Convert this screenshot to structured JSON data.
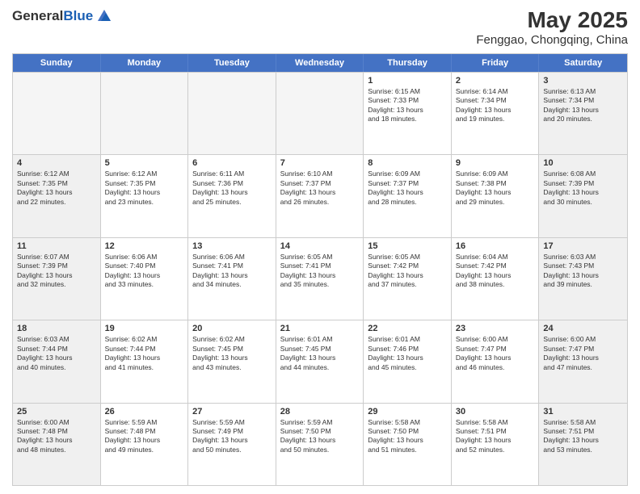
{
  "header": {
    "logo_line1": "General",
    "logo_line2": "Blue",
    "title": "May 2025",
    "subtitle": "Fenggao, Chongqing, China"
  },
  "weekdays": [
    "Sunday",
    "Monday",
    "Tuesday",
    "Wednesday",
    "Thursday",
    "Friday",
    "Saturday"
  ],
  "rows": [
    [
      {
        "day": "",
        "info": "",
        "empty": true
      },
      {
        "day": "",
        "info": "",
        "empty": true
      },
      {
        "day": "",
        "info": "",
        "empty": true
      },
      {
        "day": "",
        "info": "",
        "empty": true
      },
      {
        "day": "1",
        "info": "Sunrise: 6:15 AM\nSunset: 7:33 PM\nDaylight: 13 hours\nand 18 minutes.",
        "empty": false
      },
      {
        "day": "2",
        "info": "Sunrise: 6:14 AM\nSunset: 7:34 PM\nDaylight: 13 hours\nand 19 minutes.",
        "empty": false
      },
      {
        "day": "3",
        "info": "Sunrise: 6:13 AM\nSunset: 7:34 PM\nDaylight: 13 hours\nand 20 minutes.",
        "empty": false
      }
    ],
    [
      {
        "day": "4",
        "info": "Sunrise: 6:12 AM\nSunset: 7:35 PM\nDaylight: 13 hours\nand 22 minutes.",
        "empty": false
      },
      {
        "day": "5",
        "info": "Sunrise: 6:12 AM\nSunset: 7:35 PM\nDaylight: 13 hours\nand 23 minutes.",
        "empty": false
      },
      {
        "day": "6",
        "info": "Sunrise: 6:11 AM\nSunset: 7:36 PM\nDaylight: 13 hours\nand 25 minutes.",
        "empty": false
      },
      {
        "day": "7",
        "info": "Sunrise: 6:10 AM\nSunset: 7:37 PM\nDaylight: 13 hours\nand 26 minutes.",
        "empty": false
      },
      {
        "day": "8",
        "info": "Sunrise: 6:09 AM\nSunset: 7:37 PM\nDaylight: 13 hours\nand 28 minutes.",
        "empty": false
      },
      {
        "day": "9",
        "info": "Sunrise: 6:09 AM\nSunset: 7:38 PM\nDaylight: 13 hours\nand 29 minutes.",
        "empty": false
      },
      {
        "day": "10",
        "info": "Sunrise: 6:08 AM\nSunset: 7:39 PM\nDaylight: 13 hours\nand 30 minutes.",
        "empty": false
      }
    ],
    [
      {
        "day": "11",
        "info": "Sunrise: 6:07 AM\nSunset: 7:39 PM\nDaylight: 13 hours\nand 32 minutes.",
        "empty": false
      },
      {
        "day": "12",
        "info": "Sunrise: 6:06 AM\nSunset: 7:40 PM\nDaylight: 13 hours\nand 33 minutes.",
        "empty": false
      },
      {
        "day": "13",
        "info": "Sunrise: 6:06 AM\nSunset: 7:41 PM\nDaylight: 13 hours\nand 34 minutes.",
        "empty": false
      },
      {
        "day": "14",
        "info": "Sunrise: 6:05 AM\nSunset: 7:41 PM\nDaylight: 13 hours\nand 35 minutes.",
        "empty": false
      },
      {
        "day": "15",
        "info": "Sunrise: 6:05 AM\nSunset: 7:42 PM\nDaylight: 13 hours\nand 37 minutes.",
        "empty": false
      },
      {
        "day": "16",
        "info": "Sunrise: 6:04 AM\nSunset: 7:42 PM\nDaylight: 13 hours\nand 38 minutes.",
        "empty": false
      },
      {
        "day": "17",
        "info": "Sunrise: 6:03 AM\nSunset: 7:43 PM\nDaylight: 13 hours\nand 39 minutes.",
        "empty": false
      }
    ],
    [
      {
        "day": "18",
        "info": "Sunrise: 6:03 AM\nSunset: 7:44 PM\nDaylight: 13 hours\nand 40 minutes.",
        "empty": false
      },
      {
        "day": "19",
        "info": "Sunrise: 6:02 AM\nSunset: 7:44 PM\nDaylight: 13 hours\nand 41 minutes.",
        "empty": false
      },
      {
        "day": "20",
        "info": "Sunrise: 6:02 AM\nSunset: 7:45 PM\nDaylight: 13 hours\nand 43 minutes.",
        "empty": false
      },
      {
        "day": "21",
        "info": "Sunrise: 6:01 AM\nSunset: 7:45 PM\nDaylight: 13 hours\nand 44 minutes.",
        "empty": false
      },
      {
        "day": "22",
        "info": "Sunrise: 6:01 AM\nSunset: 7:46 PM\nDaylight: 13 hours\nand 45 minutes.",
        "empty": false
      },
      {
        "day": "23",
        "info": "Sunrise: 6:00 AM\nSunset: 7:47 PM\nDaylight: 13 hours\nand 46 minutes.",
        "empty": false
      },
      {
        "day": "24",
        "info": "Sunrise: 6:00 AM\nSunset: 7:47 PM\nDaylight: 13 hours\nand 47 minutes.",
        "empty": false
      }
    ],
    [
      {
        "day": "25",
        "info": "Sunrise: 6:00 AM\nSunset: 7:48 PM\nDaylight: 13 hours\nand 48 minutes.",
        "empty": false
      },
      {
        "day": "26",
        "info": "Sunrise: 5:59 AM\nSunset: 7:48 PM\nDaylight: 13 hours\nand 49 minutes.",
        "empty": false
      },
      {
        "day": "27",
        "info": "Sunrise: 5:59 AM\nSunset: 7:49 PM\nDaylight: 13 hours\nand 50 minutes.",
        "empty": false
      },
      {
        "day": "28",
        "info": "Sunrise: 5:59 AM\nSunset: 7:50 PM\nDaylight: 13 hours\nand 50 minutes.",
        "empty": false
      },
      {
        "day": "29",
        "info": "Sunrise: 5:58 AM\nSunset: 7:50 PM\nDaylight: 13 hours\nand 51 minutes.",
        "empty": false
      },
      {
        "day": "30",
        "info": "Sunrise: 5:58 AM\nSunset: 7:51 PM\nDaylight: 13 hours\nand 52 minutes.",
        "empty": false
      },
      {
        "day": "31",
        "info": "Sunrise: 5:58 AM\nSunset: 7:51 PM\nDaylight: 13 hours\nand 53 minutes.",
        "empty": false
      }
    ]
  ]
}
